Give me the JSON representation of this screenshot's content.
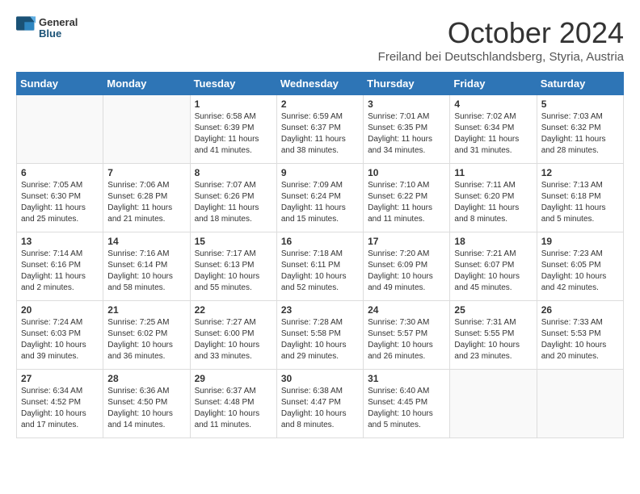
{
  "logo": {
    "general": "General",
    "blue": "Blue"
  },
  "header": {
    "month_title": "October 2024",
    "subtitle": "Freiland bei Deutschlandsberg, Styria, Austria"
  },
  "weekdays": [
    "Sunday",
    "Monday",
    "Tuesday",
    "Wednesday",
    "Thursday",
    "Friday",
    "Saturday"
  ],
  "weeks": [
    [
      {
        "day": "",
        "info": ""
      },
      {
        "day": "",
        "info": ""
      },
      {
        "day": "1",
        "info": "Sunrise: 6:58 AM\nSunset: 6:39 PM\nDaylight: 11 hours and 41 minutes."
      },
      {
        "day": "2",
        "info": "Sunrise: 6:59 AM\nSunset: 6:37 PM\nDaylight: 11 hours and 38 minutes."
      },
      {
        "day": "3",
        "info": "Sunrise: 7:01 AM\nSunset: 6:35 PM\nDaylight: 11 hours and 34 minutes."
      },
      {
        "day": "4",
        "info": "Sunrise: 7:02 AM\nSunset: 6:34 PM\nDaylight: 11 hours and 31 minutes."
      },
      {
        "day": "5",
        "info": "Sunrise: 7:03 AM\nSunset: 6:32 PM\nDaylight: 11 hours and 28 minutes."
      }
    ],
    [
      {
        "day": "6",
        "info": "Sunrise: 7:05 AM\nSunset: 6:30 PM\nDaylight: 11 hours and 25 minutes."
      },
      {
        "day": "7",
        "info": "Sunrise: 7:06 AM\nSunset: 6:28 PM\nDaylight: 11 hours and 21 minutes."
      },
      {
        "day": "8",
        "info": "Sunrise: 7:07 AM\nSunset: 6:26 PM\nDaylight: 11 hours and 18 minutes."
      },
      {
        "day": "9",
        "info": "Sunrise: 7:09 AM\nSunset: 6:24 PM\nDaylight: 11 hours and 15 minutes."
      },
      {
        "day": "10",
        "info": "Sunrise: 7:10 AM\nSunset: 6:22 PM\nDaylight: 11 hours and 11 minutes."
      },
      {
        "day": "11",
        "info": "Sunrise: 7:11 AM\nSunset: 6:20 PM\nDaylight: 11 hours and 8 minutes."
      },
      {
        "day": "12",
        "info": "Sunrise: 7:13 AM\nSunset: 6:18 PM\nDaylight: 11 hours and 5 minutes."
      }
    ],
    [
      {
        "day": "13",
        "info": "Sunrise: 7:14 AM\nSunset: 6:16 PM\nDaylight: 11 hours and 2 minutes."
      },
      {
        "day": "14",
        "info": "Sunrise: 7:16 AM\nSunset: 6:14 PM\nDaylight: 10 hours and 58 minutes."
      },
      {
        "day": "15",
        "info": "Sunrise: 7:17 AM\nSunset: 6:13 PM\nDaylight: 10 hours and 55 minutes."
      },
      {
        "day": "16",
        "info": "Sunrise: 7:18 AM\nSunset: 6:11 PM\nDaylight: 10 hours and 52 minutes."
      },
      {
        "day": "17",
        "info": "Sunrise: 7:20 AM\nSunset: 6:09 PM\nDaylight: 10 hours and 49 minutes."
      },
      {
        "day": "18",
        "info": "Sunrise: 7:21 AM\nSunset: 6:07 PM\nDaylight: 10 hours and 45 minutes."
      },
      {
        "day": "19",
        "info": "Sunrise: 7:23 AM\nSunset: 6:05 PM\nDaylight: 10 hours and 42 minutes."
      }
    ],
    [
      {
        "day": "20",
        "info": "Sunrise: 7:24 AM\nSunset: 6:03 PM\nDaylight: 10 hours and 39 minutes."
      },
      {
        "day": "21",
        "info": "Sunrise: 7:25 AM\nSunset: 6:02 PM\nDaylight: 10 hours and 36 minutes."
      },
      {
        "day": "22",
        "info": "Sunrise: 7:27 AM\nSunset: 6:00 PM\nDaylight: 10 hours and 33 minutes."
      },
      {
        "day": "23",
        "info": "Sunrise: 7:28 AM\nSunset: 5:58 PM\nDaylight: 10 hours and 29 minutes."
      },
      {
        "day": "24",
        "info": "Sunrise: 7:30 AM\nSunset: 5:57 PM\nDaylight: 10 hours and 26 minutes."
      },
      {
        "day": "25",
        "info": "Sunrise: 7:31 AM\nSunset: 5:55 PM\nDaylight: 10 hours and 23 minutes."
      },
      {
        "day": "26",
        "info": "Sunrise: 7:33 AM\nSunset: 5:53 PM\nDaylight: 10 hours and 20 minutes."
      }
    ],
    [
      {
        "day": "27",
        "info": "Sunrise: 6:34 AM\nSunset: 4:52 PM\nDaylight: 10 hours and 17 minutes."
      },
      {
        "day": "28",
        "info": "Sunrise: 6:36 AM\nSunset: 4:50 PM\nDaylight: 10 hours and 14 minutes."
      },
      {
        "day": "29",
        "info": "Sunrise: 6:37 AM\nSunset: 4:48 PM\nDaylight: 10 hours and 11 minutes."
      },
      {
        "day": "30",
        "info": "Sunrise: 6:38 AM\nSunset: 4:47 PM\nDaylight: 10 hours and 8 minutes."
      },
      {
        "day": "31",
        "info": "Sunrise: 6:40 AM\nSunset: 4:45 PM\nDaylight: 10 hours and 5 minutes."
      },
      {
        "day": "",
        "info": ""
      },
      {
        "day": "",
        "info": ""
      }
    ]
  ]
}
